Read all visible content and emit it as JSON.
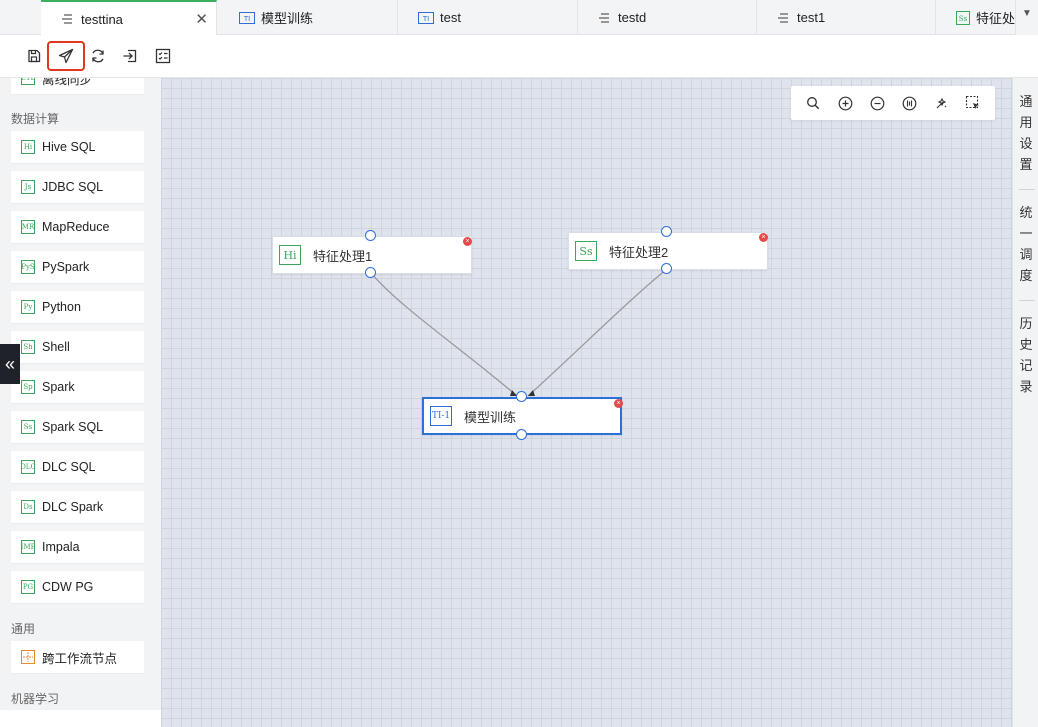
{
  "tabs": [
    {
      "label": "testtina",
      "icon": "workflow-icon",
      "active": true
    },
    {
      "label": "模型训练",
      "icon": "ti-one-icon"
    },
    {
      "label": "test",
      "icon": "ti-one-icon"
    },
    {
      "label": "testd",
      "icon": "workflow-icon"
    },
    {
      "label": "test1",
      "icon": "workflow-icon"
    },
    {
      "label": "特征处",
      "icon": "spark-sql-icon"
    }
  ],
  "tab_close": "✕",
  "tab_dropdown": "▼",
  "sidebar": {
    "partial_item": {
      "label": "离线同步",
      "icon": "ETL"
    },
    "group_compute": "数据计算",
    "compute_items": [
      {
        "label": "Hive SQL",
        "icon": "Hi"
      },
      {
        "label": "JDBC SQL",
        "icon": "Js"
      },
      {
        "label": "MapReduce",
        "icon": "MR"
      },
      {
        "label": "PySpark",
        "icon": "PyS"
      },
      {
        "label": "Python",
        "icon": "Py"
      },
      {
        "label": "Shell",
        "icon": "Sh"
      },
      {
        "label": "Spark",
        "icon": "Sp"
      },
      {
        "label": "Spark SQL",
        "icon": "Ss"
      },
      {
        "label": "DLC SQL",
        "icon": "DLC"
      },
      {
        "label": "DLC Spark",
        "icon": "Ds"
      },
      {
        "label": "Impala",
        "icon": "IMP"
      },
      {
        "label": "CDW PG",
        "icon": "PG"
      }
    ],
    "group_general": "通用",
    "general_items": [
      {
        "label": "跨工作流节点",
        "icon": "cross"
      }
    ],
    "group_ml": "机器学习",
    "collapse_glyph": "«"
  },
  "canvas": {
    "nodes": [
      {
        "label": "特征处理1",
        "icon": "Hi",
        "badge": "×"
      },
      {
        "label": "特征处理2",
        "icon": "Ss",
        "badge": "×"
      },
      {
        "label": "模型训练",
        "icon": "TI-1",
        "badge": "×"
      }
    ]
  },
  "right_panel": {
    "sections": [
      "通用设置",
      "统一调度",
      "历史记录"
    ]
  },
  "colors": {
    "accent_green": "#3fae5f",
    "accent_blue": "#2f6fd8",
    "highlight_red": "#e0371f",
    "canvas_bg": "#dfe3ec"
  }
}
